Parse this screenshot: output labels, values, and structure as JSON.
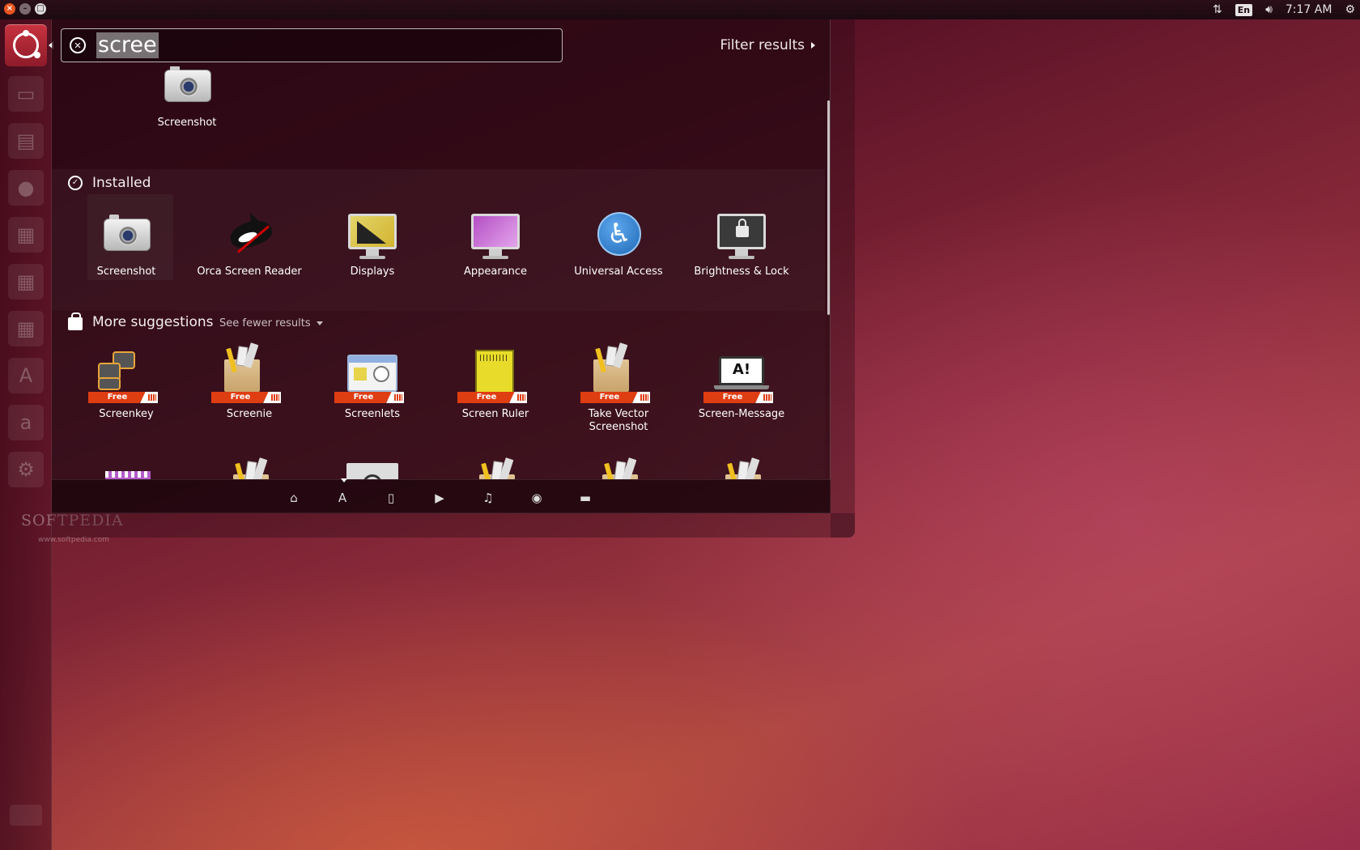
{
  "top_panel": {
    "time": "7:17 AM",
    "keyboard_layout": "En",
    "icons": [
      "network-icon",
      "keyboard-icon",
      "volume-icon",
      "gear-icon"
    ]
  },
  "search": {
    "query": "scree",
    "filter_label": "Filter results"
  },
  "top_partial_result": {
    "label": "Screenshot",
    "icon": "camera-icon"
  },
  "installed": {
    "title": "Installed",
    "items": [
      {
        "label": "Screenshot",
        "icon": "camera-icon",
        "selected": true
      },
      {
        "label": "Orca Screen Reader",
        "icon": "orca-icon"
      },
      {
        "label": "Displays",
        "icon": "display-icon"
      },
      {
        "label": "Appearance",
        "icon": "appearance-icon"
      },
      {
        "label": "Universal Access",
        "icon": "accessibility-icon"
      },
      {
        "label": "Brightness & Lock",
        "icon": "lock-screen-icon"
      }
    ]
  },
  "suggestions": {
    "title": "More suggestions",
    "see_fewer_label": "See fewer results",
    "free_label": "Free",
    "items": [
      {
        "label": "Screenkey",
        "icon": "screenkey-icon"
      },
      {
        "label": "Screenie",
        "icon": "package-icon"
      },
      {
        "label": "Screenlets",
        "icon": "screenlets-icon"
      },
      {
        "label": "Screen Ruler",
        "icon": "ruler-icon"
      },
      {
        "label": "Take Vector Screenshot",
        "icon": "package-icon"
      },
      {
        "label": "Screen-Message",
        "icon": "screen-message-icon"
      }
    ],
    "partial_row_icons": [
      "cheese-icon",
      "package-icon",
      "magnifier-icon",
      "package-icon",
      "package-icon",
      "package-icon"
    ]
  },
  "lenses": [
    "home-lens-icon",
    "applications-lens-icon",
    "files-lens-icon",
    "video-lens-icon",
    "music-lens-icon",
    "photo-lens-icon",
    "social-lens-icon"
  ],
  "watermark": {
    "name": "SOFTPEDIA",
    "url": "www.softpedia.com"
  },
  "colors": {
    "accent": "#e95420",
    "free_badge": "#df3d12"
  }
}
